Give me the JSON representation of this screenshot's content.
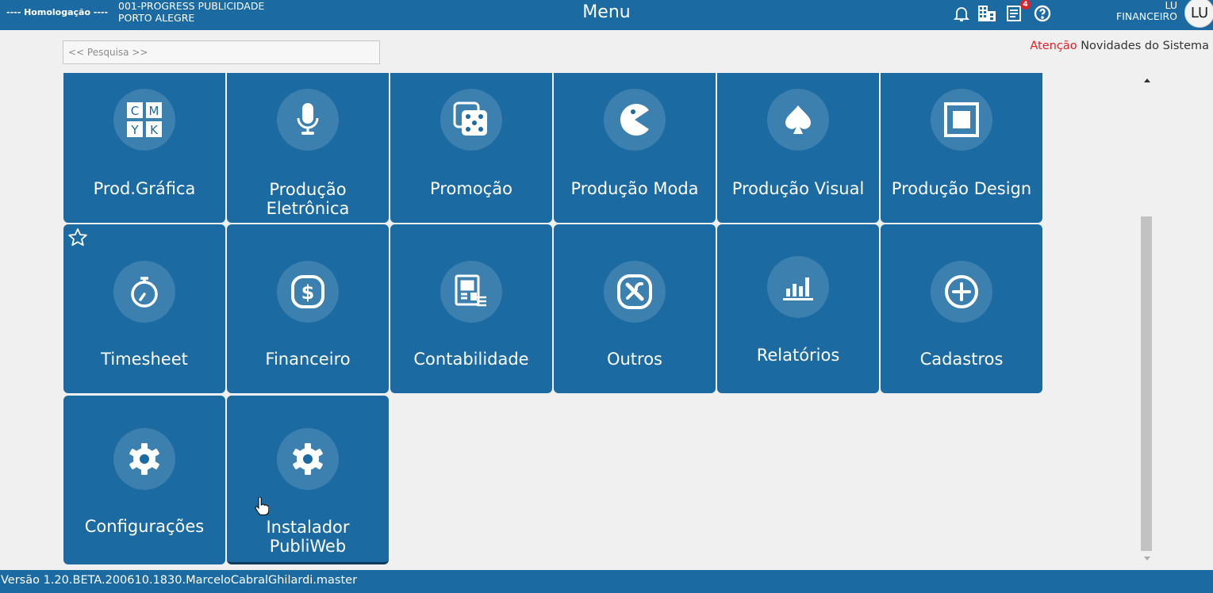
{
  "header": {
    "environment": "---- Homologação ----",
    "company_line1": "001-PROGRESS PUBLICIDADE",
    "company_line2": "PORTO ALEGRE",
    "title": "Menu",
    "notifications_badge": "4",
    "user_initials_line": "LU",
    "user_role": "FINANCEIRO",
    "avatar_initials": "LU",
    "icons": [
      "bell-icon",
      "building-icon",
      "document-icon",
      "help-icon"
    ]
  },
  "search": {
    "placeholder": "<< Pesquisa >>"
  },
  "notice": {
    "warning": "Atenção",
    "text": "Novidades do Sistema"
  },
  "tiles": [
    {
      "label": "Prod.Gráfica",
      "icon": "cmyk-icon"
    },
    {
      "label": "Produção Eletrônica",
      "icon": "microphone-icon"
    },
    {
      "label": "Promoção",
      "icon": "dice-icon"
    },
    {
      "label": "Produção Moda",
      "icon": "pacman-icon"
    },
    {
      "label": "Produção Visual",
      "icon": "spade-icon"
    },
    {
      "label": "Produção Design",
      "icon": "square-icon"
    },
    {
      "label": "Timesheet",
      "icon": "stopwatch-icon"
    },
    {
      "label": "Financeiro",
      "icon": "dollar-icon"
    },
    {
      "label": "Contabilidade",
      "icon": "ledger-icon"
    },
    {
      "label": "Outros",
      "icon": "tools-icon"
    },
    {
      "label": "Relatórios",
      "icon": "bar-chart-icon"
    },
    {
      "label": "Cadastros",
      "icon": "plus-circle-icon"
    },
    {
      "label": "Configurações",
      "icon": "gear-icon"
    },
    {
      "label": "Instalador PubliWeb",
      "icon": "gear-icon"
    }
  ],
  "cmyk_letters": [
    "C",
    "M",
    "Y",
    "K"
  ],
  "footer": {
    "version": "Versão 1.20.BETA.200610.1830.MarceloCabralGhilardi.master"
  },
  "colors": {
    "primary": "#1b6aa1",
    "warning": "#e01f25",
    "background": "#f0f0f0"
  }
}
